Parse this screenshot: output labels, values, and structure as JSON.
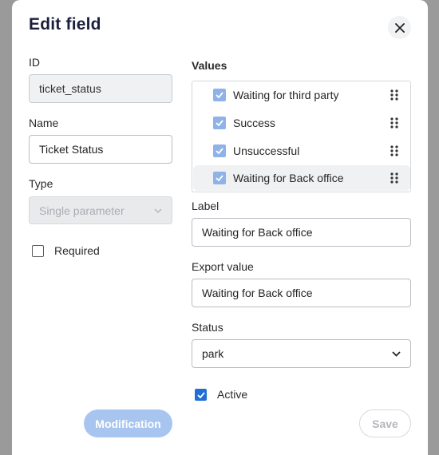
{
  "dialog": {
    "title": "Edit field",
    "close_icon": "close-icon"
  },
  "left": {
    "id_label": "ID",
    "id_value": "ticket_status",
    "name_label": "Name",
    "name_value": "Ticket Status",
    "type_label": "Type",
    "type_value": "Single parameter",
    "required_label": "Required",
    "required_checked": false
  },
  "right": {
    "values_label": "Values",
    "values": [
      {
        "label": "Waiting for third party",
        "checked": true
      },
      {
        "label": "Success",
        "checked": true
      },
      {
        "label": "Unsuccessful",
        "checked": true
      },
      {
        "label": "Waiting for Back office",
        "checked": true
      }
    ],
    "selected_value_index": 3,
    "label_label": "Label",
    "label_value": "Waiting for Back office",
    "export_label": "Export value",
    "export_value": "Waiting for Back office",
    "status_label": "Status",
    "status_value": "park",
    "active_label": "Active",
    "active_checked": true
  },
  "buttons": {
    "modification": "Modification",
    "save": "Save"
  },
  "colors": {
    "accent": "#1f6fd6",
    "accent_light": "#a8c5f0",
    "title": "#1b1f3b"
  }
}
